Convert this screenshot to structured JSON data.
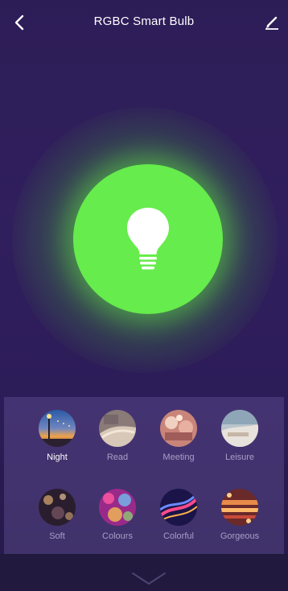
{
  "header": {
    "title": "RGBC Smart Bulb",
    "back_icon": "chevron-left-icon",
    "edit_icon": "pencil-icon"
  },
  "bulb": {
    "color": "#66ec4c",
    "icon": "lightbulb-icon",
    "state": "on"
  },
  "scenes": [
    {
      "label": "Night",
      "selected": true
    },
    {
      "label": "Read",
      "selected": false
    },
    {
      "label": "Meeting",
      "selected": false
    },
    {
      "label": "Leisure",
      "selected": false
    },
    {
      "label": "Soft",
      "selected": false
    },
    {
      "label": "Colours",
      "selected": false
    },
    {
      "label": "Colorful",
      "selected": false
    },
    {
      "label": "Gorgeous",
      "selected": false
    }
  ],
  "footer": {
    "collapse_icon": "chevron-down-icon"
  },
  "colors": {
    "background": "#301f5d",
    "accent": "#66ec4c",
    "label_inactive": "#a89fc6",
    "label_active": "#ffffff"
  }
}
